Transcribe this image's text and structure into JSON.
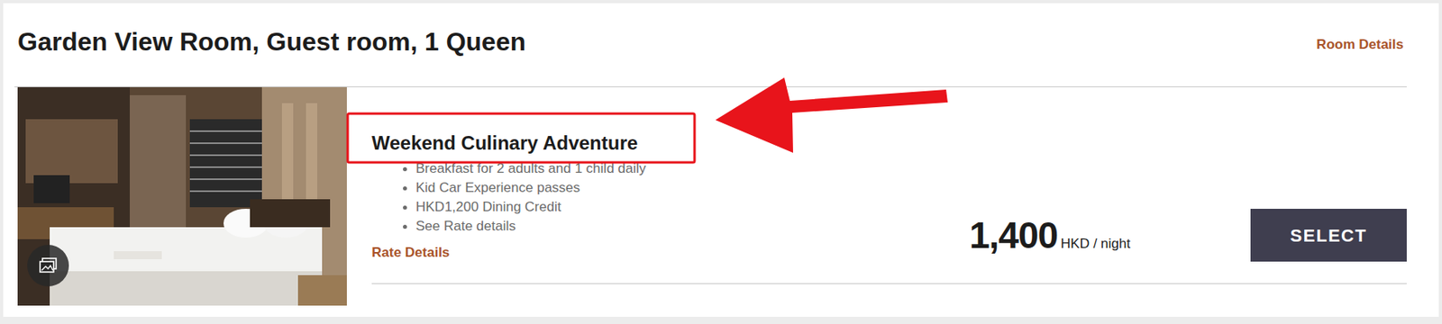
{
  "room": {
    "title": "Garden View Room, Guest room, 1 Queen",
    "details_link": "Room Details"
  },
  "rate": {
    "name": "Weekend Culinary Adventure",
    "highlighted": true,
    "inclusions": [
      "Breakfast for 2 adults and 1 child daily",
      "Kid Car Experience passes",
      "HKD1,200 Dining Credit",
      "See Rate details"
    ],
    "details_link": "Rate Details",
    "price": "1,400",
    "unit": "HKD / night",
    "button": "SELECT"
  }
}
